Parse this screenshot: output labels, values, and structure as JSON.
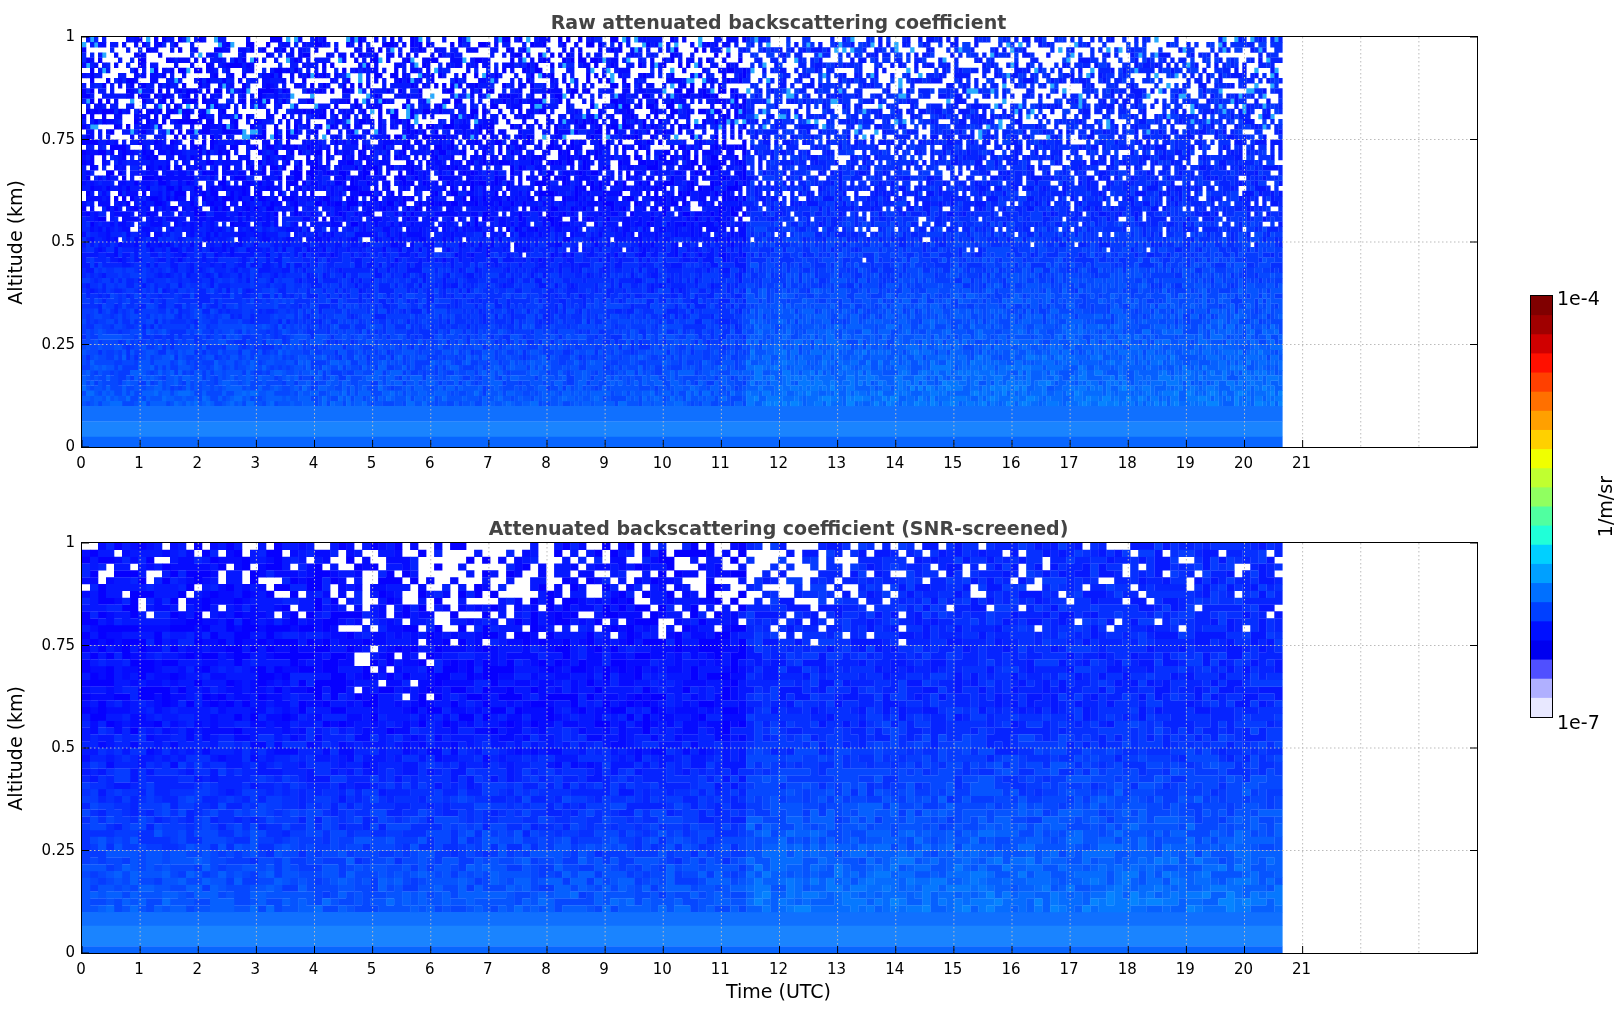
{
  "panels": [
    {
      "kind": "raw",
      "title": "Raw attenuated backscattering coefficient",
      "ylabel": "Altitude (km)",
      "yticks": [
        "1",
        "0.75",
        "0.5",
        "0.25",
        "0"
      ],
      "xticks": [
        "0",
        "1",
        "2",
        "3",
        "4",
        "5",
        "6",
        "7",
        "8",
        "9",
        "10",
        "11",
        "12",
        "13",
        "14",
        "15",
        "16",
        "17",
        "18",
        "19",
        "20",
        "21"
      ]
    },
    {
      "kind": "screened",
      "title": "Attenuated backscattering coefficient (SNR-screened)",
      "ylabel": "Altitude (km)",
      "yticks": [
        "1",
        "0.75",
        "0.5",
        "0.25",
        "0"
      ],
      "xticks": [
        "0",
        "1",
        "2",
        "3",
        "4",
        "5",
        "6",
        "7",
        "8",
        "9",
        "10",
        "11",
        "12",
        "13",
        "14",
        "15",
        "16",
        "17",
        "18",
        "19",
        "20",
        "21"
      ],
      "xlabel": "Time (UTC)"
    }
  ],
  "colorbar": {
    "max_label": "1e-4",
    "min_label": "1e-7",
    "unit": "1/m/sr"
  }
}
